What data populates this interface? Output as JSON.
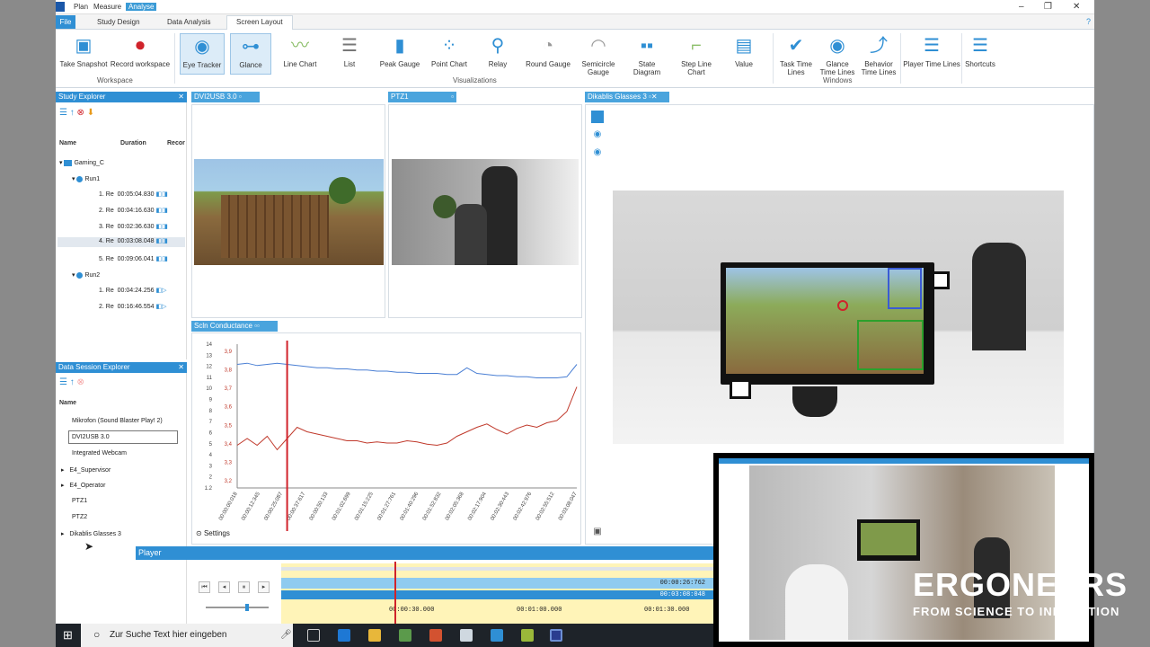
{
  "title_menu": [
    "Plan",
    "Measure",
    "Analyse"
  ],
  "ribbon_tabs": {
    "file": "File",
    "tabs": [
      "Study Design",
      "Data Analysis",
      "Screen Layout"
    ]
  },
  "ribbon": {
    "workspace": {
      "group": "Workspace",
      "take_snapshot": "Take Snapshot",
      "record_workspace": "Record workspace"
    },
    "visualizations": {
      "group": "Visualizations",
      "items": [
        "Eye Tracker",
        "Glance",
        "Line Chart",
        "List",
        "Peak Gauge",
        "Point Chart",
        "Relay",
        "Round Gauge",
        "Semicircle Gauge",
        "State Diagram",
        "Step Line Chart",
        "Value"
      ]
    },
    "windows": {
      "group": "Windows",
      "items": [
        "Task Time Lines",
        "Glance Time Lines",
        "Behavior Time Lines",
        "Player Time Lines",
        "Shortcuts"
      ]
    }
  },
  "study_explorer": {
    "title": "Study Explorer",
    "columns": [
      "Name",
      "Duration",
      "Recor"
    ],
    "project": "Gaming_C",
    "runs": [
      {
        "label": "Run1",
        "items": [
          {
            "name": "1. Re",
            "duration": "00:05:04.830"
          },
          {
            "name": "2. Re",
            "duration": "00:04:16.630"
          },
          {
            "name": "3. Re",
            "duration": "00:02:36.630"
          },
          {
            "name": "4. Re",
            "duration": "00:03:08.048"
          },
          {
            "name": "5. Re",
            "duration": "00:09:06.041"
          }
        ]
      },
      {
        "label": "Run2",
        "items": [
          {
            "name": "1. Re",
            "duration": "00:04:24.256"
          },
          {
            "name": "2. Re",
            "duration": "00:16:46.554"
          }
        ]
      }
    ]
  },
  "data_session_explorer": {
    "title": "Data Session Explorer",
    "column": "Name",
    "items": [
      "Mikrofon (Sound Blaster Play! 2)",
      "DVI2USB 3.0",
      "Integrated Webcam",
      "E4_Supervisor",
      "E4_Operator",
      "PTZ1",
      "PTZ2",
      "Dikablis Glasses 3"
    ]
  },
  "panels": {
    "dvi": "DVI2USB 3.0",
    "ptz": "PTZ1",
    "dikablis": "Dikablis Glasses 3",
    "scl": "Scln Conductance",
    "settings": "Settings"
  },
  "chart_data": {
    "type": "line",
    "title": "",
    "ylim": [
      1.2,
      14
    ],
    "yticks": [
      "14",
      "13",
      "12",
      "11",
      "10",
      "9",
      "8",
      "7",
      "6",
      "5",
      "4",
      "3",
      "2",
      "1.2"
    ],
    "y_left_ticks": [
      "3,9",
      "3,8",
      "3,7",
      "3,6",
      "3,5",
      "3,4",
      "3,3",
      "3,2"
    ],
    "xticks": [
      "00:00:00:018",
      "00:00:12:345",
      "00:00:25:087",
      "00:00:37:617",
      "00:00:50:133",
      "00:01:02:699",
      "00:01:15:225",
      "00:01:27:761",
      "00:01:40:296",
      "00:01:52:832",
      "00:02:05:368",
      "00:02:17:904",
      "00:02:30:443",
      "00:02:42:976",
      "00:02:55:512",
      "00:03:08:047"
    ],
    "series": [
      {
        "color": "#4a7fd4",
        "values": [
          12.2,
          12.3,
          12.1,
          12.2,
          12.3,
          12.2,
          12.1,
          12.0,
          11.9,
          11.9,
          11.8,
          11.8,
          11.7,
          11.7,
          11.6,
          11.6,
          11.5,
          11.5,
          11.4,
          11.4,
          11.4,
          11.3,
          11.3,
          11.9,
          11.4,
          11.3,
          11.2,
          11.2,
          11.1,
          11.1,
          11.0,
          11.0,
          11.0,
          11.1,
          12.2
        ]
      },
      {
        "color": "#c0392b",
        "values": [
          5.0,
          5.6,
          5.0,
          5.8,
          4.6,
          5.6,
          6.6,
          6.2,
          6.0,
          5.8,
          5.6,
          5.4,
          5.4,
          5.2,
          5.3,
          5.2,
          5.2,
          5.4,
          5.3,
          5.1,
          5.0,
          5.2,
          5.8,
          6.2,
          6.6,
          6.9,
          6.4,
          6.0,
          6.5,
          6.8,
          6.6,
          7.0,
          7.2,
          8.0,
          10.2
        ]
      }
    ],
    "cursor_index": 5
  },
  "player": {
    "title": "Player",
    "time_total": "00:00:26:762",
    "time_current": "00:03:08:048",
    "ticks": [
      "00:00:30.000",
      "00:01:00.000",
      "00:01:30.000"
    ]
  },
  "taskbar": {
    "search": "Zur Suche Text hier eingeben"
  },
  "branding": {
    "name": "ERGONEERS",
    "tagline": "FROM SCIENCE TO INNOVATION"
  },
  "colors": {
    "accent": "#2f8fd4",
    "timeline": "#fff4b8"
  }
}
